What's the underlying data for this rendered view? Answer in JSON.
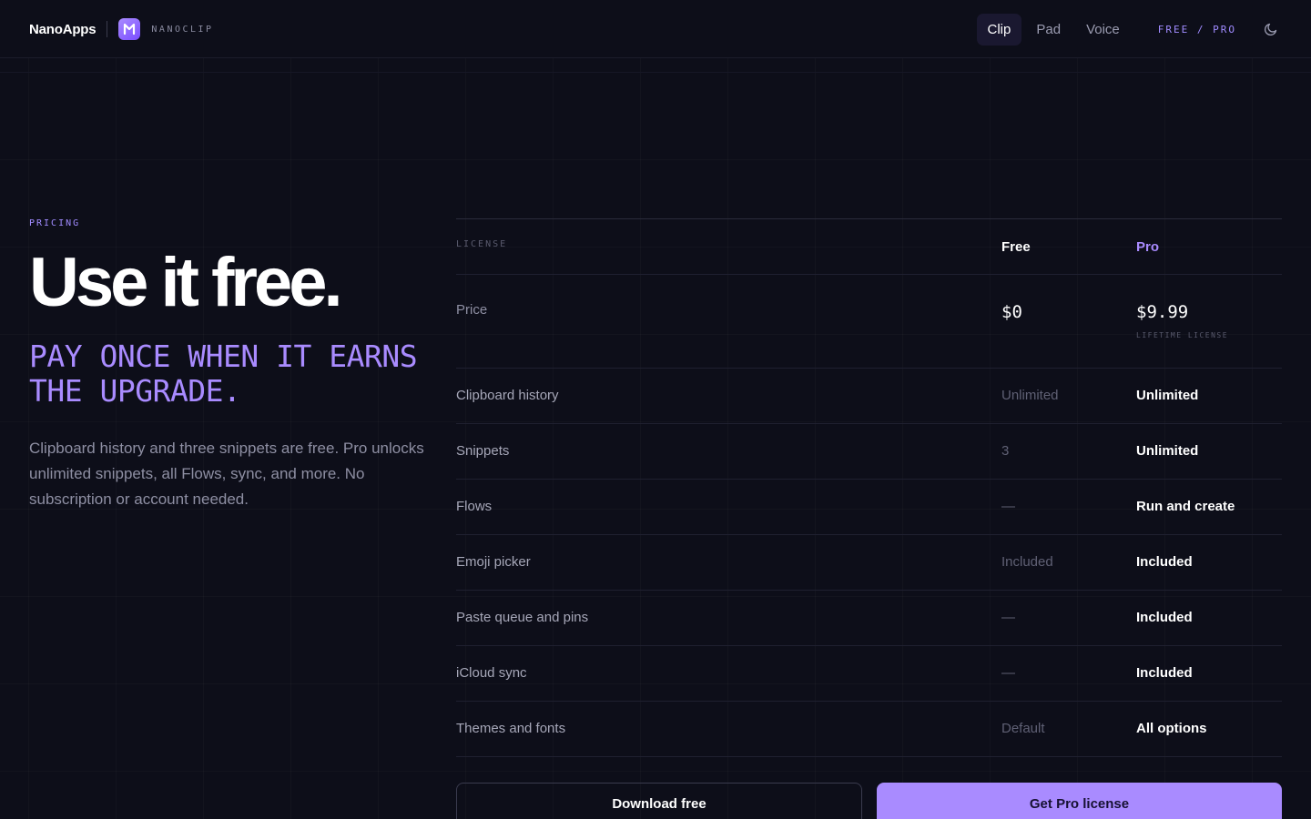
{
  "header": {
    "brand": "NanoApps",
    "app_name": "NANOCLIP",
    "tabs": [
      {
        "label": "Clip",
        "active": true
      },
      {
        "label": "Pad",
        "active": false
      },
      {
        "label": "Voice",
        "active": false
      }
    ],
    "edition": "FREE / PRO",
    "theme_icon": "moon-icon",
    "logo_icon": "nanoclip-logo-icon"
  },
  "hero": {
    "eyebrow": "PRICING",
    "title": "Use it free.",
    "subtitle": "PAY ONCE WHEN IT EARNS THE UPGRADE.",
    "description": "Clipboard history and three snippets are free. Pro unlocks unlimited snippets, all Flows, sync, and more. No subscription or account needed."
  },
  "table": {
    "header": {
      "label": "LICENSE",
      "free": "Free",
      "pro": "Pro"
    },
    "price": {
      "label": "Price",
      "free": "$0",
      "pro": "$9.99",
      "pro_note": "LIFETIME LICENSE"
    },
    "rows": [
      {
        "feature": "Clipboard history",
        "free": "Unlimited",
        "pro": "Unlimited"
      },
      {
        "feature": "Snippets",
        "free": "3",
        "pro": "Unlimited"
      },
      {
        "feature": "Flows",
        "free": "—",
        "pro": "Run and create"
      },
      {
        "feature": "Emoji picker",
        "free": "Included",
        "pro": "Included"
      },
      {
        "feature": "Paste queue and pins",
        "free": "—",
        "pro": "Included"
      },
      {
        "feature": "iCloud sync",
        "free": "—",
        "pro": "Included"
      },
      {
        "feature": "Themes and fonts",
        "free": "Default",
        "pro": "All options"
      }
    ]
  },
  "actions": {
    "download_free": "Download free",
    "get_pro": "Get Pro license"
  },
  "colors": {
    "background": "#0d0e19",
    "accent": "#a98bff",
    "text": "#ffffff",
    "muted": "#8e8fa3"
  }
}
